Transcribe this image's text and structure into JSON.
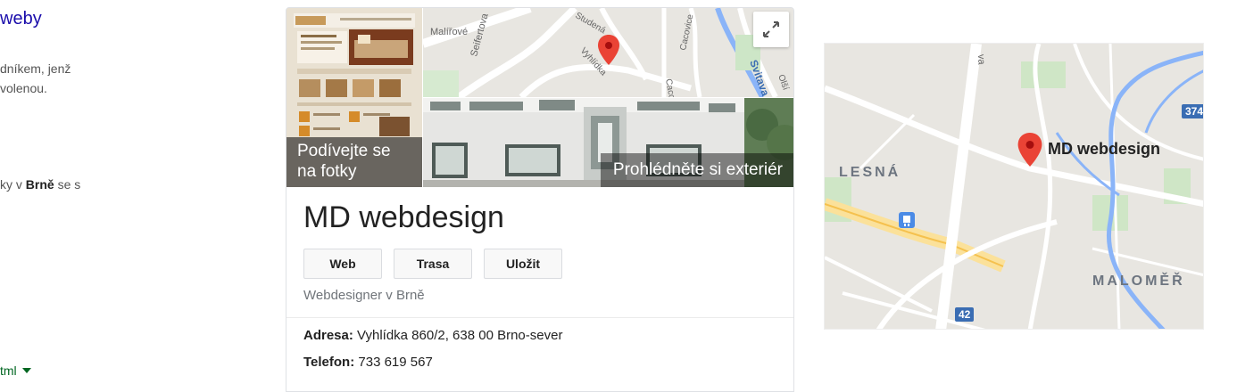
{
  "left_results": {
    "link_fragment": "weby",
    "snippet_fragment": "dníkem, jenž\nvolenou.",
    "snippet2_prefix": "ky v ",
    "snippet2_bold": "Brně",
    "snippet2_suffix": " se s",
    "url_fragment": "tml"
  },
  "knowledge_panel": {
    "photo_overlay": "Podívejte se na fotky",
    "exterior_overlay": "Prohlédněte si exteriér",
    "mini_map_streets": [
      "Seifertova",
      "Malířové",
      "Studená",
      "Vyhlídka",
      "Cacovice",
      "Svitava",
      "Cacov",
      "Olší"
    ],
    "title": "MD webdesign",
    "buttons": [
      "Web",
      "Trasa",
      "Uložit"
    ],
    "category": "Webdesigner v Brně",
    "address_label": "Adresa:",
    "address_value": " Vyhlídka 860/2, 638 00 Brno-sever",
    "phone_label": "Telefon:",
    "phone_value": " 733 619 567"
  },
  "right_map": {
    "place_label": "MD webdesign",
    "district_left": "LESNÁ",
    "district_right": "MALOMĚŘ",
    "route_shield_top": "374",
    "route_shield_bottom": "42"
  },
  "colors": {
    "link": "#1a0dab",
    "url_green": "#006621",
    "pin_red": "#ea4335",
    "river_blue": "#8ab4f8"
  },
  "icons": [
    "expand-icon",
    "map-pin-icon",
    "tram-stop-icon",
    "dropdown-triangle-icon"
  ]
}
